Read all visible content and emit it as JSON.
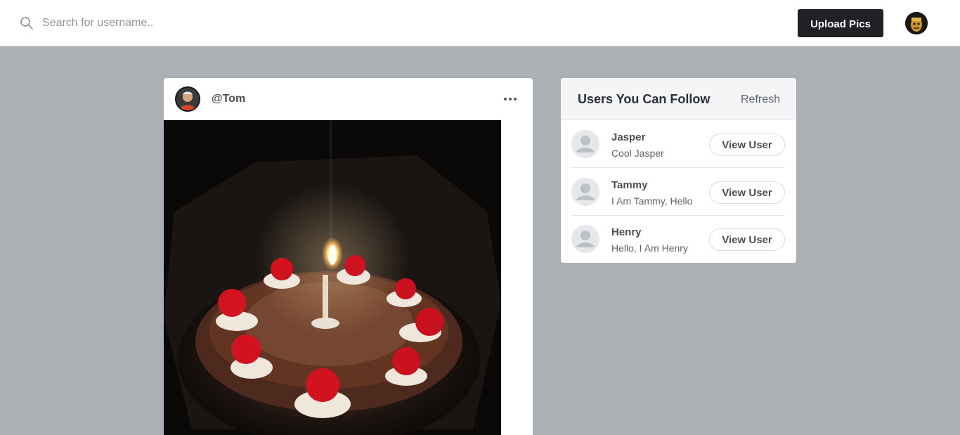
{
  "search": {
    "placeholder": "Search for username.."
  },
  "header": {
    "upload_label": "Upload Pics"
  },
  "post": {
    "username": "@Tom"
  },
  "suggestions": {
    "title": "Users You Can Follow",
    "refresh_label": "Refresh",
    "users": [
      {
        "name": "Jasper",
        "bio": "Cool Jasper",
        "button_label": "View User"
      },
      {
        "name": "Tammy",
        "bio": "I Am Tammy, Hello",
        "button_label": "View User"
      },
      {
        "name": "Henry",
        "bio": "Hello, I Am Henry",
        "button_label": "View User"
      }
    ]
  },
  "icons": {
    "search": "search-icon",
    "more": "more-horizontal-icon",
    "default_avatar": "user-silhouette-icon"
  },
  "colors": {
    "topbar": "#ffffff",
    "background": "#acafb3",
    "primary_button": "#202124"
  }
}
